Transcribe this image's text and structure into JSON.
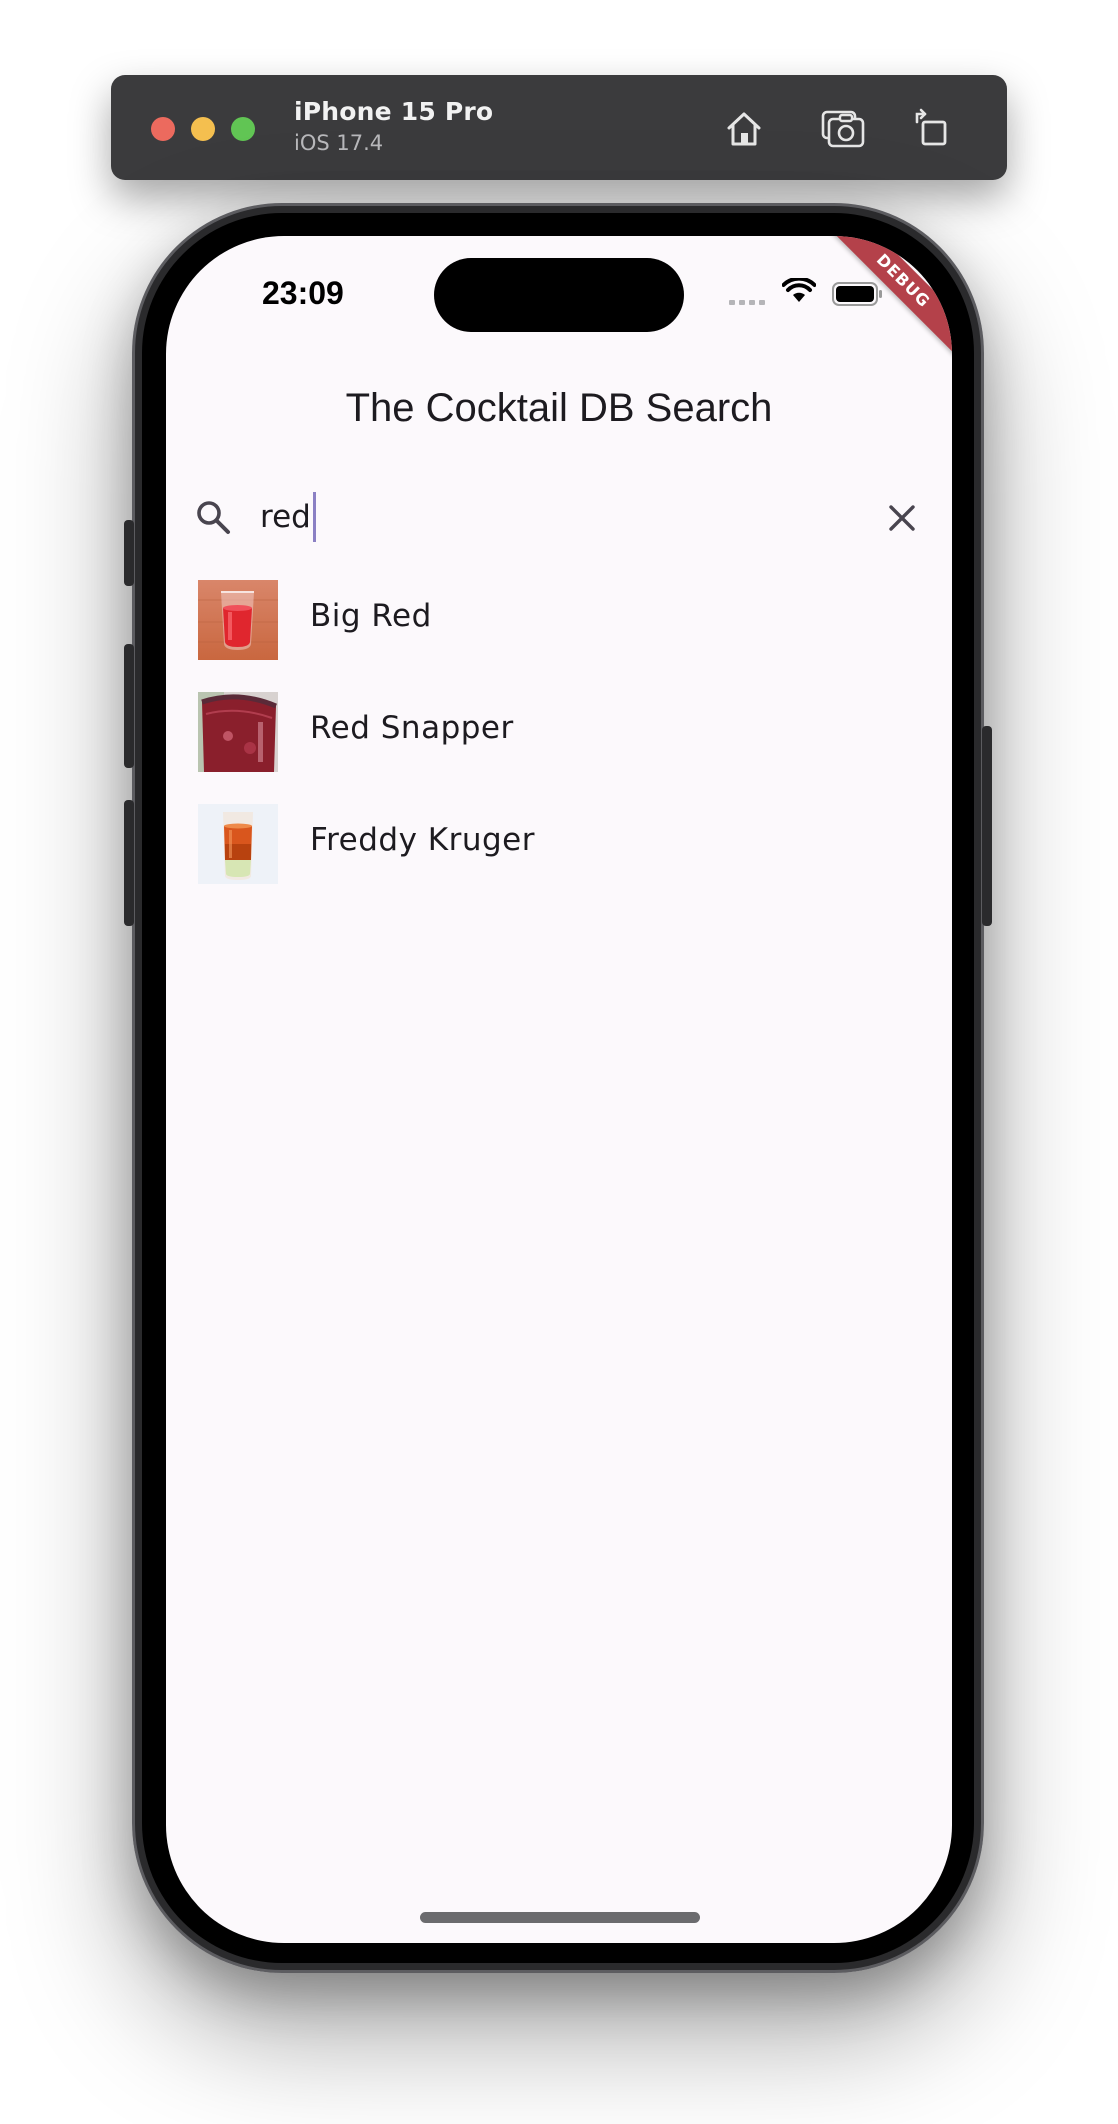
{
  "simulator": {
    "device_name": "iPhone 15 Pro",
    "os_version": "iOS 17.4",
    "buttons": [
      "home-icon",
      "screenshot-icon",
      "rotate-icon"
    ]
  },
  "status_bar": {
    "time": "23:09",
    "debug_label": "DEBUG"
  },
  "app": {
    "title": "The Cocktail DB Search",
    "search": {
      "value": "red",
      "placeholder": ""
    },
    "results": [
      {
        "name": "Big Red",
        "thumb": "red-drink-photo"
      },
      {
        "name": "Red Snapper",
        "thumb": "red-snapper-photo"
      },
      {
        "name": "Freddy Kruger",
        "thumb": "orange-shot-photo"
      }
    ]
  },
  "colors": {
    "screen_background": "#fcf9fc",
    "debug_ribbon": "#b4414a",
    "caret": "#8b80c4",
    "text": "#1d1b20"
  }
}
